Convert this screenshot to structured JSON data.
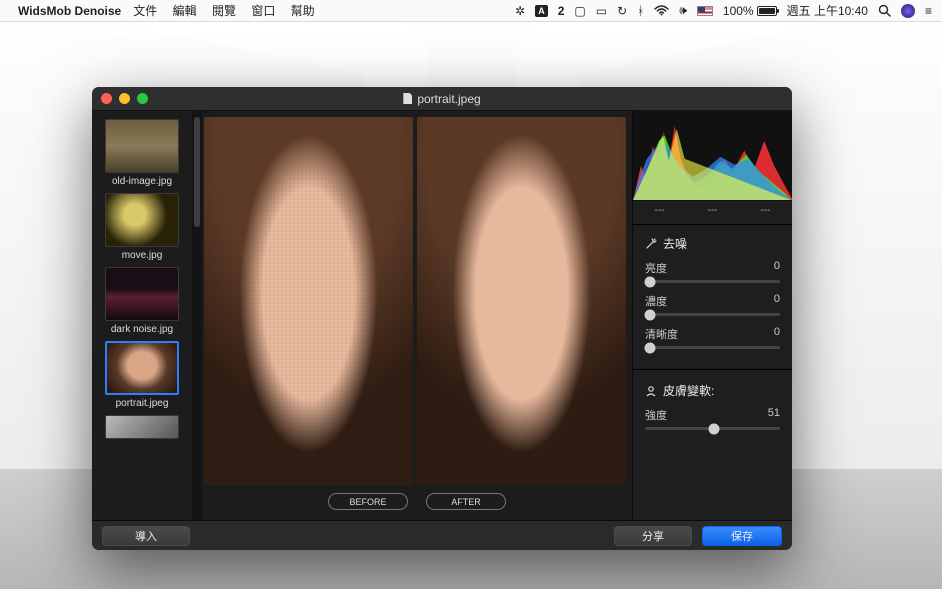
{
  "menubar": {
    "app_name": "WidsMob Denoise",
    "menus": [
      "文件",
      "編輯",
      "閱覽",
      "窗口",
      "幫助"
    ],
    "right": {
      "adobe": "A",
      "battery_pct": "100%",
      "battery_label": "",
      "datetime": "週五 上午10:40"
    }
  },
  "window": {
    "title": "portrait.jpeg"
  },
  "sidebar": {
    "items": [
      {
        "label": "old-image.jpg"
      },
      {
        "label": "move.jpg"
      },
      {
        "label": "dark noise.jpg"
      },
      {
        "label": "portrait.jpeg"
      },
      {
        "label": ""
      }
    ]
  },
  "preview": {
    "before_label": "BEFORE",
    "after_label": "AFTER"
  },
  "histogram": {
    "readouts": [
      "---",
      "---",
      "---"
    ]
  },
  "panel": {
    "denoise_title": "去噪",
    "sliders": {
      "luminance": {
        "label": "亮度",
        "value": "0",
        "pos": 0
      },
      "chrominance": {
        "label": "濃度",
        "value": "0",
        "pos": 0
      },
      "sharpness": {
        "label": "清晰度",
        "value": "0",
        "pos": 0
      }
    },
    "skin_title": "皮膚變軟:",
    "skin_slider": {
      "label": "強度",
      "value": "51",
      "pos": 51
    }
  },
  "footer": {
    "import": "導入",
    "share": "分享",
    "save": "保存"
  }
}
